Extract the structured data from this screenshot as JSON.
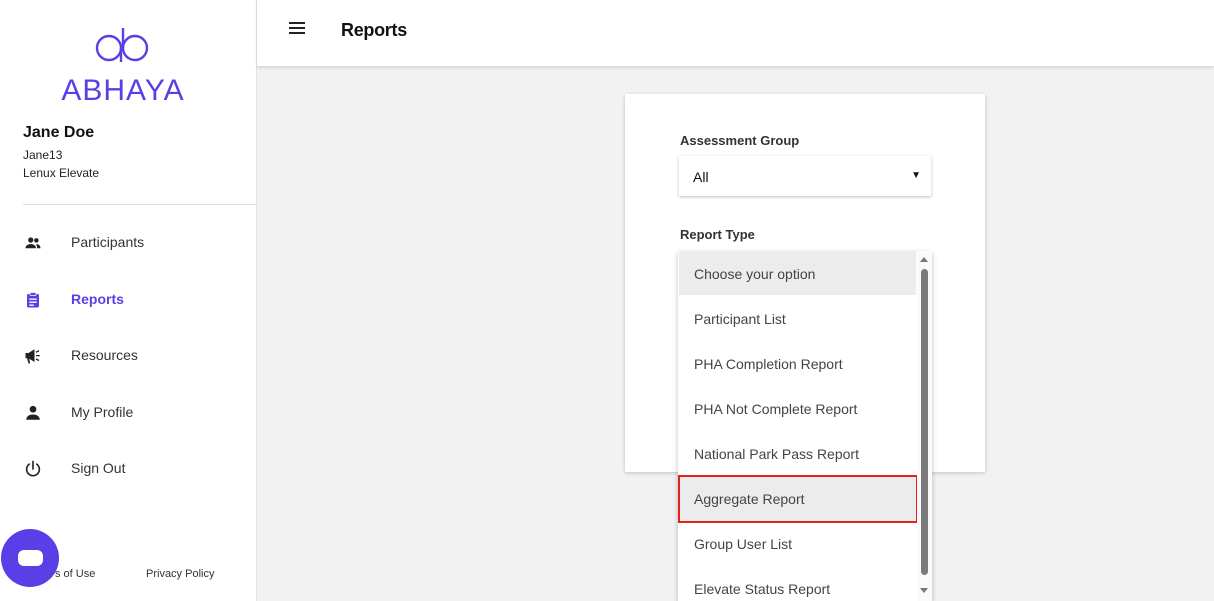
{
  "brand": {
    "name": "ABHAYA",
    "color": "#5b3ee6"
  },
  "user": {
    "name": "Jane Doe",
    "handle": "Jane13",
    "organization": "Lenux Elevate"
  },
  "sidebar": {
    "items": [
      {
        "label": "Participants",
        "icon": "participants-icon",
        "active": false
      },
      {
        "label": "Reports",
        "icon": "clipboard-icon",
        "active": true
      },
      {
        "label": "Resources",
        "icon": "megaphone-icon",
        "active": false
      },
      {
        "label": "My Profile",
        "icon": "person-icon",
        "active": false
      },
      {
        "label": "Sign Out",
        "icon": "power-icon",
        "active": false
      }
    ],
    "footer": {
      "terms": "s of Use",
      "privacy": "Privacy Policy"
    }
  },
  "header": {
    "title": "Reports"
  },
  "form": {
    "assessment_group": {
      "label": "Assessment Group",
      "value": "All"
    },
    "report_type": {
      "label": "Report Type",
      "options": [
        "Choose your option",
        "Participant List",
        "PHA Completion Report",
        "PHA Not Complete Report",
        "National Park Pass Report",
        "Aggregate Report",
        "Group User List",
        "Elevate Status Report"
      ],
      "hovered_option": "Choose your option",
      "highlighted_option": "Aggregate Report"
    }
  },
  "colors": {
    "accent": "#5b3ee6",
    "highlight_border": "#e2231a"
  }
}
